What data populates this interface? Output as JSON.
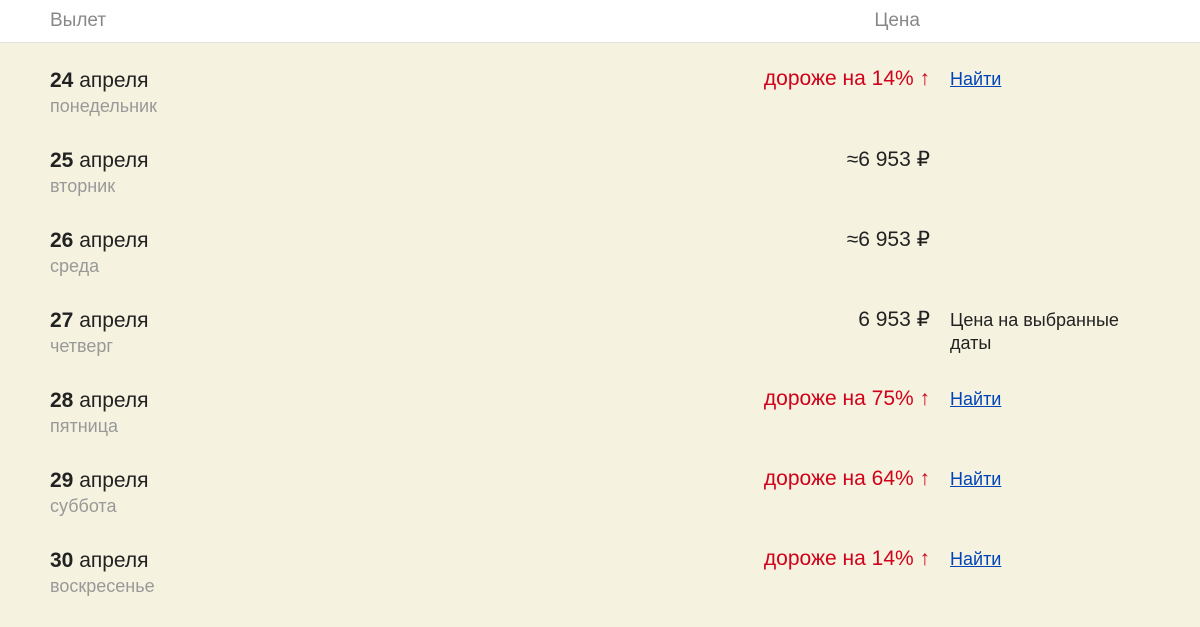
{
  "header": {
    "departure": "Вылет",
    "price": "Цена"
  },
  "find_label": "Найти",
  "selected_note": "Цена на выбранные даты",
  "currency": "₽",
  "rows": [
    {
      "day": "24",
      "month": "апреля",
      "weekday": "понедельник",
      "price_kind": "rel",
      "price_text": "дороже на 14% ↑",
      "action": "find"
    },
    {
      "day": "25",
      "month": "апреля",
      "weekday": "вторник",
      "price_kind": "approx",
      "price_text": "≈6 953 ₽",
      "action": ""
    },
    {
      "day": "26",
      "month": "апреля",
      "weekday": "среда",
      "price_kind": "approx",
      "price_text": "≈6 953 ₽",
      "action": ""
    },
    {
      "day": "27",
      "month": "апреля",
      "weekday": "четверг",
      "price_kind": "exact",
      "price_text": "6 953 ₽",
      "action": "note"
    },
    {
      "day": "28",
      "month": "апреля",
      "weekday": "пятница",
      "price_kind": "rel",
      "price_text": "дороже на 75% ↑",
      "action": "find"
    },
    {
      "day": "29",
      "month": "апреля",
      "weekday": "суббота",
      "price_kind": "rel",
      "price_text": "дороже на 64% ↑",
      "action": "find"
    },
    {
      "day": "30",
      "month": "апреля",
      "weekday": "воскресенье",
      "price_kind": "rel",
      "price_text": "дороже на 14% ↑",
      "action": "find"
    }
  ]
}
